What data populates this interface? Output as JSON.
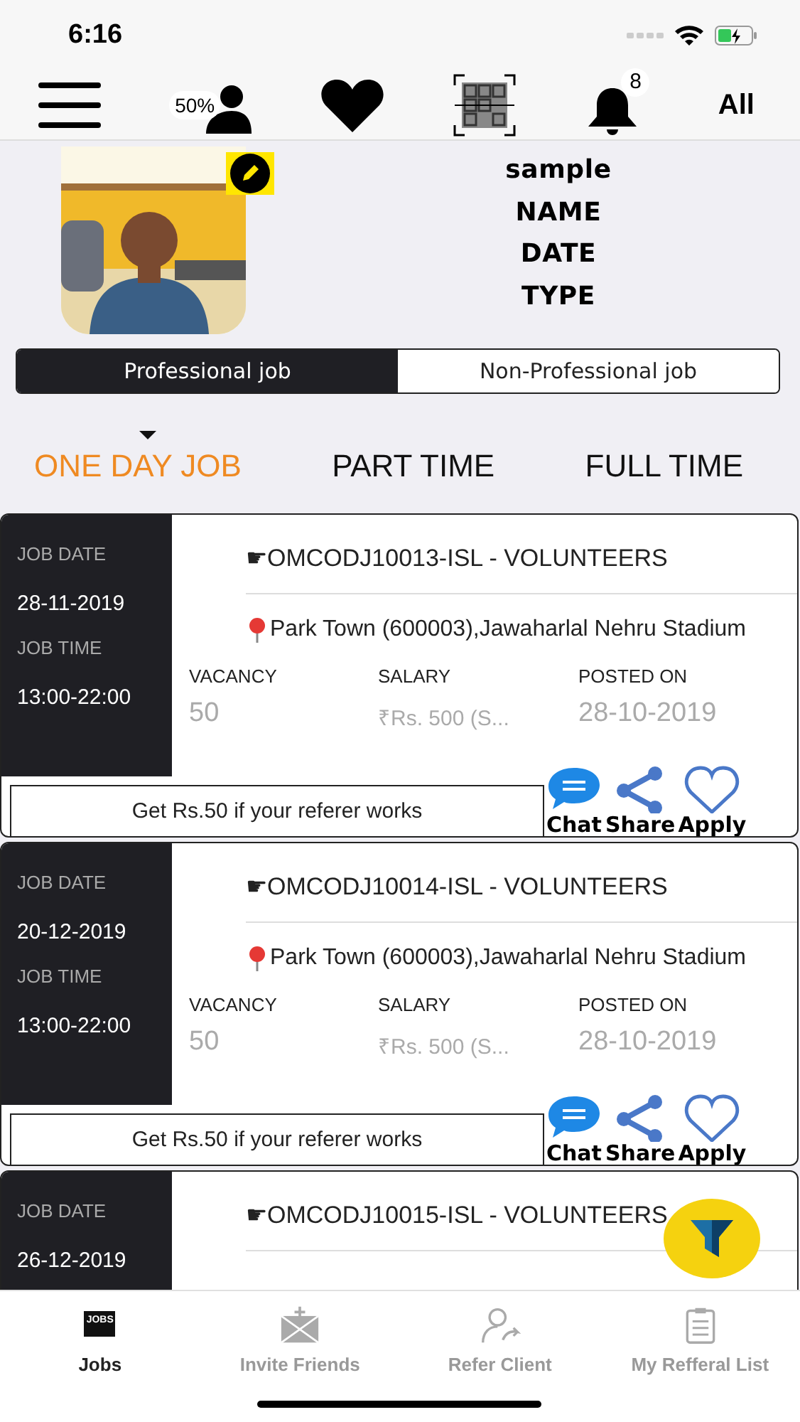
{
  "status_bar": {
    "time": "6:16"
  },
  "toolbar": {
    "profile_completion": "50%",
    "notification_count": "8",
    "filter_label": "All"
  },
  "profile": {
    "lines": [
      "sample",
      "NAME",
      "DATE",
      "TYPE"
    ]
  },
  "job_categories": [
    {
      "label": "Professional job",
      "selected": true
    },
    {
      "label": "Non-Professional job",
      "selected": false
    }
  ],
  "job_type_tabs": [
    {
      "label": "ONE DAY JOB",
      "selected": true
    },
    {
      "label": "PART TIME",
      "selected": false
    },
    {
      "label": "FULL TIME",
      "selected": false
    }
  ],
  "jobs": [
    {
      "date_label": "JOB DATE",
      "date": "28-11-2019",
      "time_label": "JOB TIME",
      "time": "13:00-22:00",
      "title": "☛OMCODJ10013-ISL - VOLUNTEERS",
      "location": "Park Town (600003),Jawaharlal Nehru Stadium",
      "vacancy_label": "VACANCY",
      "vacancy": "50",
      "salary_label": "SALARY",
      "salary": "₹Rs. 500 (S...",
      "posted_label": "POSTED ON",
      "posted": "28-10-2019",
      "referral": "Get Rs.50 if your referer works",
      "actions": [
        {
          "kind": "chat",
          "label": "Chat"
        },
        {
          "kind": "share",
          "label": "Share"
        },
        {
          "kind": "apply",
          "label": "Apply"
        }
      ]
    },
    {
      "date_label": "JOB DATE",
      "date": "20-12-2019",
      "time_label": "JOB TIME",
      "time": "13:00-22:00",
      "title": "☛OMCODJ10014-ISL - VOLUNTEERS",
      "location": "Park Town (600003),Jawaharlal Nehru Stadium",
      "vacancy_label": "VACANCY",
      "vacancy": "50",
      "salary_label": "SALARY",
      "salary": "₹Rs. 500 (S...",
      "posted_label": "POSTED ON",
      "posted": "28-10-2019",
      "referral": "Get Rs.50 if your referer works",
      "actions": [
        {
          "kind": "chat",
          "label": "Chat"
        },
        {
          "kind": "share",
          "label": "Share"
        },
        {
          "kind": "apply",
          "label": "Apply"
        }
      ]
    },
    {
      "date_label": "JOB DATE",
      "date": "26-12-2019",
      "title": "☛OMCODJ10015-ISL - VOLUNTEERS"
    }
  ],
  "bottom_tabs": [
    {
      "kind": "jobs",
      "label": "Jobs",
      "icon_text": "JOBS",
      "selected": true
    },
    {
      "kind": "invite",
      "label": "Invite Friends",
      "selected": false
    },
    {
      "kind": "refer",
      "label": "Refer Client",
      "selected": false
    },
    {
      "kind": "list",
      "label": "My Refferal List",
      "selected": false
    }
  ]
}
